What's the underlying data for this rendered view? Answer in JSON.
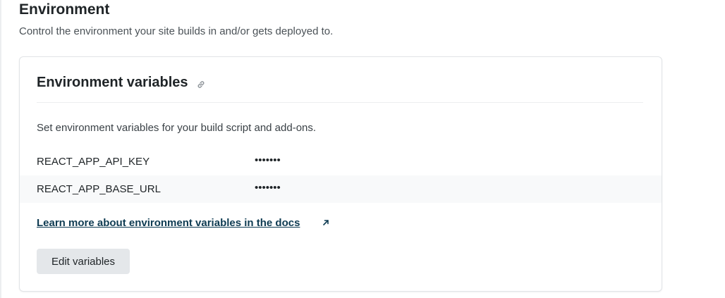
{
  "section": {
    "title": "Environment",
    "description": "Control the environment your site builds in and/or gets deployed to."
  },
  "card": {
    "title": "Environment variables",
    "description": "Set environment variables for your build script and add-ons.",
    "variables": [
      {
        "key": "REACT_APP_API_KEY",
        "value": "•••••••"
      },
      {
        "key": "REACT_APP_BASE_URL",
        "value": "•••••••"
      }
    ],
    "docs_link": "Learn more about environment variables in the docs",
    "edit_button": "Edit variables"
  },
  "colors": {
    "link": "#0e3b52",
    "button_bg": "#e4e7ea",
    "row_alt_bg": "#f8f9fa"
  },
  "icons": [
    "link-icon",
    "external-arrow-icon"
  ]
}
